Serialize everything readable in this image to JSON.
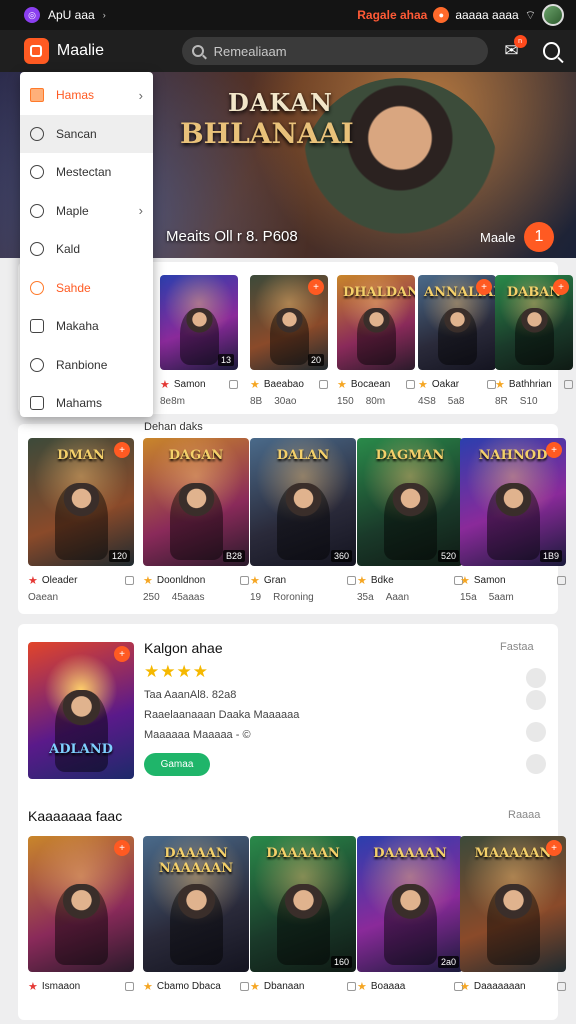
{
  "status_bar": {
    "app_name": "ApU aaa",
    "alert_text": "Ragale ahaa",
    "right_text": "aaaaa aaaa"
  },
  "app_bar": {
    "brand": "Maalie",
    "search_placeholder": "Remealiaam",
    "notif_count": "n"
  },
  "menu": {
    "items": [
      {
        "label": "Hamas",
        "has_arrow": true
      },
      {
        "label": "Sancan",
        "has_arrow": false
      },
      {
        "label": "Mestectan",
        "has_arrow": false
      },
      {
        "label": "Maple",
        "has_arrow": true
      },
      {
        "label": "Kald",
        "has_arrow": false
      },
      {
        "label": "Sahde",
        "has_arrow": false
      },
      {
        "label": "Makaha",
        "has_arrow": false
      },
      {
        "label": "Ranbione",
        "has_arrow": false
      },
      {
        "label": "Mahams",
        "has_arrow": false
      }
    ]
  },
  "hero": {
    "title_line1": "DAKAN",
    "title_line2": "BHLANAAI",
    "caption": "Meaits Oll r 8. P608",
    "more_label": "Maale",
    "next_label": "1"
  },
  "row1": {
    "tiles": [
      {
        "art_title": "",
        "chip": "13",
        "name": "Samon",
        "rating": "8e8m",
        "count": "",
        "badge": ""
      },
      {
        "art_title": "",
        "chip": "20",
        "name": "Baeabao",
        "rating": "8B",
        "count": "30ao",
        "badge": "+"
      },
      {
        "art_title": "DHALDANIA",
        "chip": "",
        "name": "Bocaean",
        "rating": "150",
        "count": "80m",
        "badge": ""
      },
      {
        "art_title": "ANNALIANE",
        "chip": "",
        "name": "Oakar",
        "rating": "4S8",
        "count": "5a8",
        "badge": "+"
      },
      {
        "art_title": "DABAN",
        "chip": "",
        "name": "Bathhrian",
        "rating": "8R",
        "count": "S10",
        "badge": "+"
      }
    ]
  },
  "row2": {
    "label": "Dehan daks",
    "tiles": [
      {
        "art_title": "DMAN",
        "chip": "120",
        "name": "Oleader",
        "rating": "Oaean",
        "count": "",
        "badge": "+"
      },
      {
        "art_title": "DAGAN",
        "chip": "B28",
        "name": "Doonldnon",
        "rating": "250",
        "count": "45aaas",
        "badge": ""
      },
      {
        "art_title": "DALAN",
        "chip": "360",
        "name": "Gran",
        "rating": "19",
        "count": "Roroning",
        "badge": ""
      },
      {
        "art_title": "DAGMAN",
        "chip": "520",
        "name": "Bdke",
        "rating": "35a",
        "count": "Aaan",
        "badge": ""
      },
      {
        "art_title": "NAHNOD",
        "chip": "1B9",
        "name": "Samon",
        "rating": "15a",
        "count": "5aam",
        "badge": "+"
      }
    ]
  },
  "featured": {
    "title": "Kalgon ahae",
    "rating_stars": "★★★★",
    "line1": "Taa AaanAl8. 82a8",
    "line2": "Raaelaanaaan Daaka Maaaaaa",
    "line3": "Maaaaaa Maaaaa - ©",
    "cta": "Gamaa",
    "link": "Fastaa",
    "art_title": "ADLAND"
  },
  "row3": {
    "header": "Kaaaaaaa faac",
    "link": "Raaaa",
    "tiles": [
      {
        "art_title": "",
        "chip": "",
        "name": "Ismaaon",
        "rating": "",
        "count": "",
        "badge": "+"
      },
      {
        "art_title": "DAAAAN NAAAAAN",
        "chip": "",
        "name": "Cbamo Dbaca",
        "rating": "",
        "count": "",
        "badge": ""
      },
      {
        "art_title": "DAAAAAN",
        "chip": "160",
        "name": "Dbanaan",
        "rating": "",
        "count": "",
        "badge": ""
      },
      {
        "art_title": "DAAAAAN",
        "chip": "2a0",
        "name": "Boaaaa",
        "rating": "",
        "count": "",
        "badge": ""
      },
      {
        "art_title": "MAAAAAN",
        "chip": "",
        "name": "Daaaaaaan",
        "rating": "",
        "count": "",
        "badge": "+"
      }
    ]
  }
}
